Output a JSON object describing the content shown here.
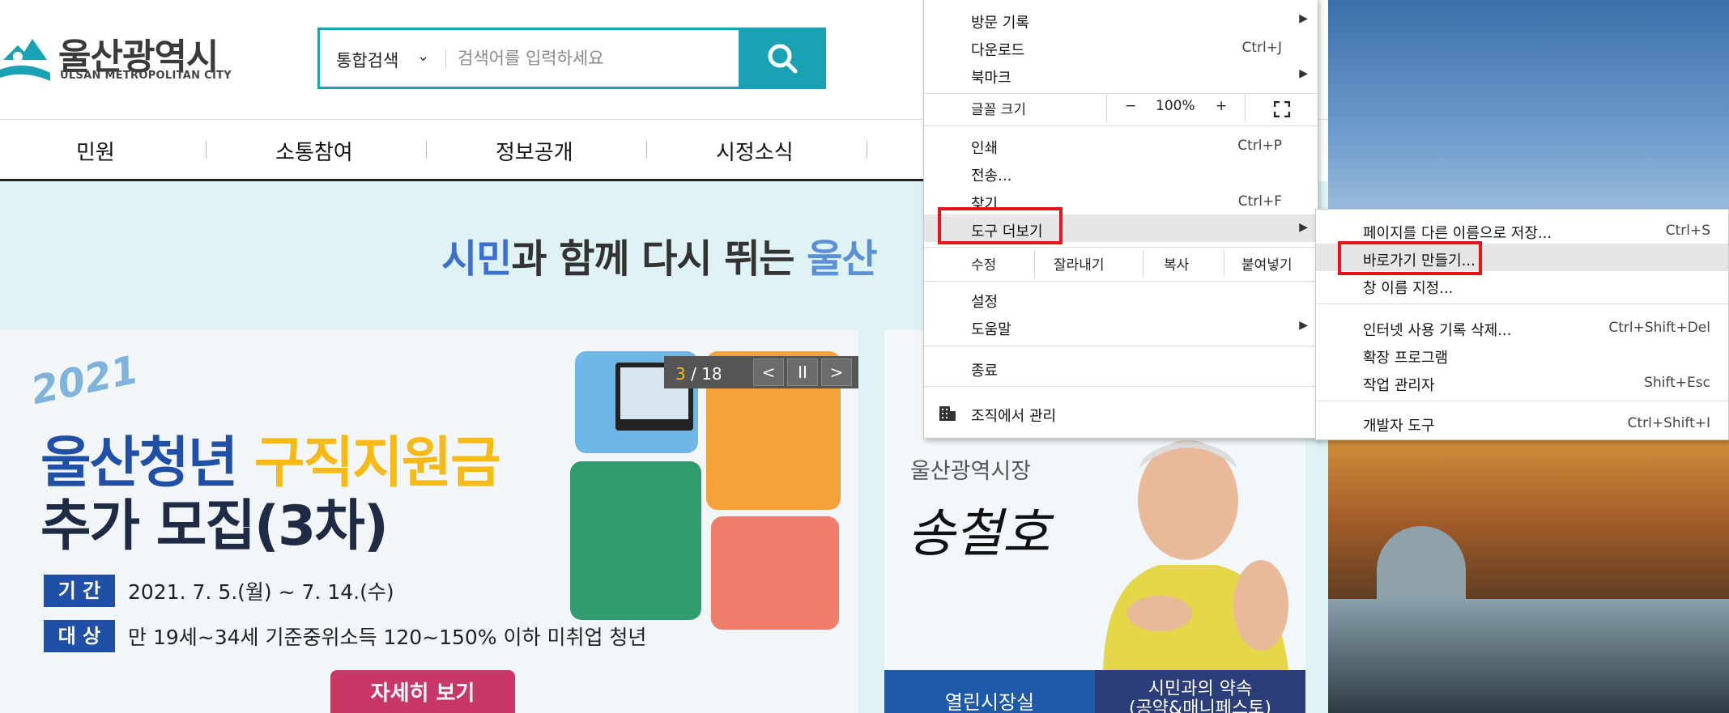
{
  "site": {
    "logo_title": "울산광역시",
    "logo_subtitle": "ULSAN METROPOLITAN CITY",
    "search": {
      "type_label": "통합검색",
      "placeholder": "검색어를 입력하세요",
      "value": ""
    },
    "nav": [
      "민원",
      "소통참여",
      "정보공개",
      "시정소식"
    ],
    "slogan": {
      "part1": "시민",
      "part2": "과 함께 다시 뛰는 ",
      "part3": "울산"
    },
    "banner": {
      "year": "2021",
      "title_line1_a": "울산청년 ",
      "title_line1_b": "구직지원금",
      "title_line2": "추가 모집(3차)",
      "period_tag": "기 간",
      "period_text": "2021. 7. 5.(월) ~ 7. 14.(수)",
      "target_tag": "대 상",
      "target_text": "만 19세~34세 기준중위소득 120~150% 이하 미취업 청년",
      "more_button": "자세히 보기"
    },
    "pager": {
      "current": "3",
      "total": "/ 18",
      "prev": "<",
      "pause": "II",
      "next": ">"
    },
    "mayor": {
      "subtitle": "울산광역시장",
      "name": "송철호",
      "tab1": "열린시장실",
      "tab2_line1": "시민과의 약속",
      "tab2_line2": "(공약&매니페스토)"
    }
  },
  "chrome_menu": {
    "items": [
      {
        "label": "방문 기록",
        "shortcut": "",
        "submenu": true
      },
      {
        "label": "다운로드",
        "shortcut": "Ctrl+J",
        "submenu": false
      },
      {
        "label": "북마크",
        "shortcut": "",
        "submenu": true
      }
    ],
    "zoom": {
      "label": "글꼴 크기",
      "minus": "−",
      "value": "100%",
      "plus": "+"
    },
    "items2": [
      {
        "label": "인쇄",
        "shortcut": "Ctrl+P"
      },
      {
        "label": "전송...",
        "shortcut": ""
      },
      {
        "label": "찾기",
        "shortcut": "Ctrl+F"
      },
      {
        "label": "도구 더보기",
        "shortcut": ""
      }
    ],
    "edit": {
      "label": "수정",
      "cut": "잘라내기",
      "copy": "복사",
      "paste": "붙여넣기"
    },
    "items3": [
      {
        "label": "설정"
      },
      {
        "label": "도움말"
      },
      {
        "label": "종료"
      },
      {
        "label": "조직에서 관리"
      }
    ]
  },
  "more_tools_submenu": [
    {
      "label": "페이지를 다른 이름으로 저장...",
      "shortcut": "Ctrl+S"
    },
    {
      "label": "바로가기 만들기...",
      "shortcut": ""
    },
    {
      "label": "창 이름 지정...",
      "shortcut": ""
    },
    {
      "label": "인터넷 사용 기록 삭제...",
      "shortcut": "Ctrl+Shift+Del"
    },
    {
      "label": "확장 프로그램",
      "shortcut": ""
    },
    {
      "label": "작업 관리자",
      "shortcut": "Shift+Esc"
    },
    {
      "label": "개발자 도구",
      "shortcut": "Ctrl+Shift+I"
    }
  ],
  "colors": {
    "accent": "#1aa2b4",
    "highlight_box": "#e8141c",
    "banner_blue": "#1f4fa6",
    "banner_yellow": "#f6b915",
    "more_button": "#c83766"
  }
}
